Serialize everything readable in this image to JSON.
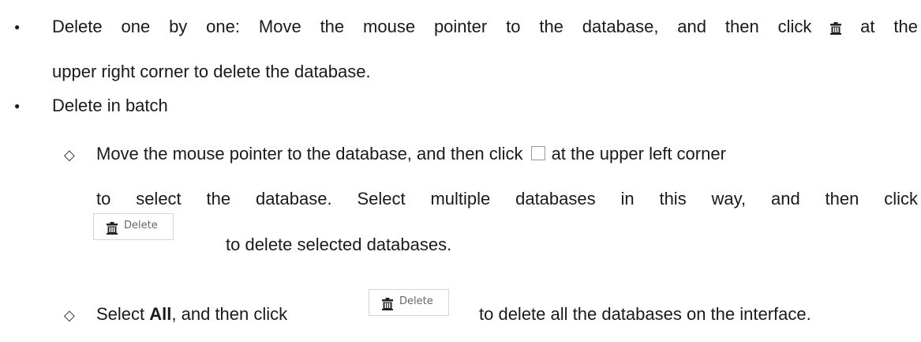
{
  "item1": {
    "line1_text": "Delete one by one: Move the mouse pointer to the database, and then click",
    "line1_end": "at the",
    "line2": "upper right corner to delete the database.",
    "trash_icon": "trash-icon"
  },
  "item2": {
    "label": "Delete in batch"
  },
  "sub1": {
    "line1_text": "Move the mouse pointer to the database, and then click",
    "line1_end": "at the upper left corner",
    "line2": "to select the database. Select multiple databases in this way, and then click",
    "line3": "to delete selected databases."
  },
  "sub2": {
    "pre": "Select",
    "bold": "All",
    "mid": ", and then click",
    "post": "to delete all the databases on the interface."
  },
  "delete_button": {
    "label": "Delete"
  },
  "icons": {
    "bullet": "●",
    "diamond": "◇"
  }
}
